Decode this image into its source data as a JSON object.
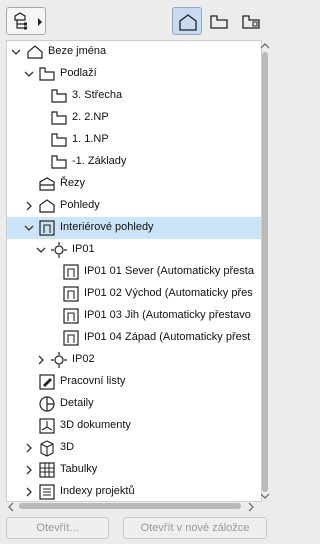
{
  "toolbar": {
    "dropdown_icon": "project-map-icon",
    "view_buttons": [
      "project-map-view",
      "view-map-view",
      "layout-book-view"
    ]
  },
  "tree": {
    "root": "Beze jména",
    "podlazi": "Podlaží",
    "floors": [
      "3. Střecha",
      "2. 2.NP",
      "1. 1.NP",
      "-1. Základy"
    ],
    "rezy": "Řezy",
    "pohledy": "Pohledy",
    "interior": "Interiérové pohledy",
    "ip01": "IP01",
    "ip01_items": [
      "IP01 01 Sever (Automaticky přesta",
      "IP01 02 Východ (Automaticky přes",
      "IP01 03 Jih (Automaticky přestavo",
      "IP01 04 Západ (Automaticky přest"
    ],
    "ip02": "IP02",
    "pracovni": "Pracovní listy",
    "detaily": "Detaily",
    "dok3d": "3D dokumenty",
    "item3d": "3D",
    "tabulky": "Tabulky",
    "indexy": "Indexy projektů"
  },
  "buttons": {
    "open": "Otevřít...",
    "open_tab": "Otevřít v nové záložce"
  },
  "colors": {
    "selection": "#cce4f7",
    "active_toolbar": "#c9daf0",
    "panel_bg": "#ececec"
  }
}
